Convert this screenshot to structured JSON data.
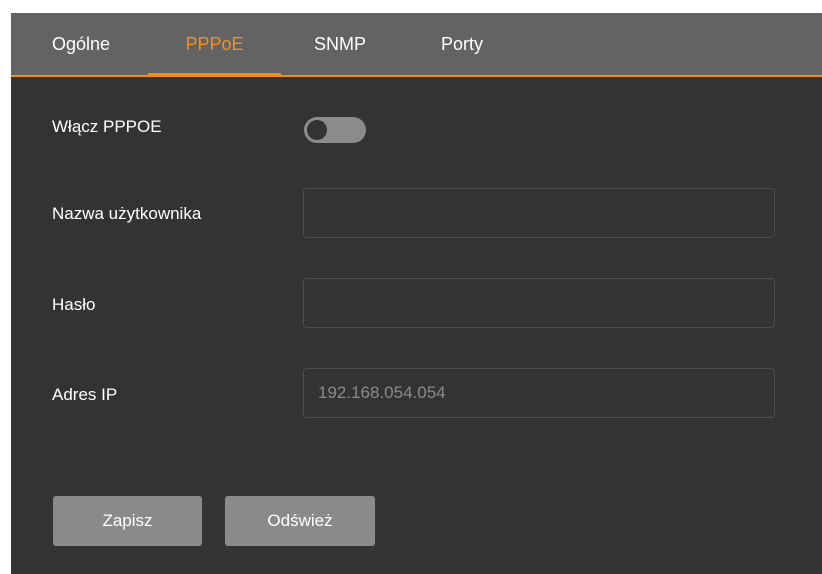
{
  "tabs": [
    {
      "label": "Ogólne"
    },
    {
      "label": "PPPoE"
    },
    {
      "label": "SNMP"
    },
    {
      "label": "Porty"
    }
  ],
  "active_tab": "PPPoE",
  "form": {
    "enable_label": "Włącz PPPOE",
    "enable_state": "off",
    "username_label": "Nazwa użytkownika",
    "username_value": "",
    "password_label": "Hasło",
    "password_value": "",
    "ip_label": "Adres IP",
    "ip_placeholder": "192.168.054.054"
  },
  "buttons": {
    "save_label": "Zapisz",
    "refresh_label": "Odśwież"
  },
  "colors": {
    "accent": "#f08c1a",
    "background": "#333333",
    "tabbar": "#636363",
    "button": "#8a8a8a"
  }
}
